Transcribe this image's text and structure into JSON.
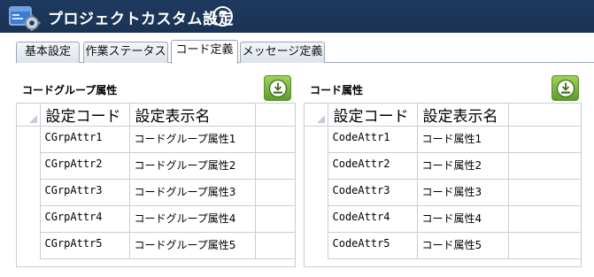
{
  "window": {
    "title": "プロジェクトカスタム設定",
    "help_icon": "question-circle-icon"
  },
  "tabs": [
    {
      "label": "基本設定",
      "active": false
    },
    {
      "label": "作業ステータス",
      "active": false
    },
    {
      "label": "コード定義",
      "active": true
    },
    {
      "label": "メッセージ定義",
      "active": false
    }
  ],
  "colors": {
    "titlebar": "#1f3a60",
    "download_button": "#7ab840",
    "grid_line": "#c9cdd3"
  },
  "group_panel": {
    "title": "コードグループ属性",
    "download_icon": "download-icon",
    "columns": [
      "設定コード",
      "設定表示名"
    ],
    "rows": [
      {
        "code": "CGrpAttr1",
        "name": "コードグループ属性1"
      },
      {
        "code": "CGrpAttr2",
        "name": "コードグループ属性2"
      },
      {
        "code": "CGrpAttr3",
        "name": "コードグループ属性3"
      },
      {
        "code": "CGrpAttr4",
        "name": "コードグループ属性4"
      },
      {
        "code": "CGrpAttr5",
        "name": "コードグループ属性5"
      }
    ]
  },
  "code_panel": {
    "title": "コード属性",
    "download_icon": "download-icon",
    "columns": [
      "設定コード",
      "設定表示名"
    ],
    "rows": [
      {
        "code": "CodeAttr1",
        "name": "コード属性1"
      },
      {
        "code": "CodeAttr2",
        "name": "コード属性2"
      },
      {
        "code": "CodeAttr3",
        "name": "コード属性3"
      },
      {
        "code": "CodeAttr4",
        "name": "コード属性4"
      },
      {
        "code": "CodeAttr5",
        "name": "コード属性5"
      }
    ]
  }
}
